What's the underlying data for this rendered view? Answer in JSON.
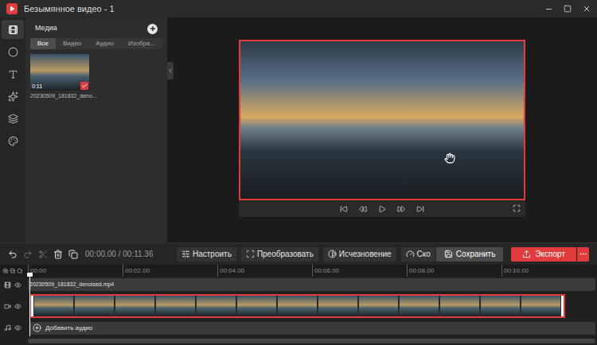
{
  "window": {
    "title": "Безымянное видео - 1"
  },
  "sidebar": {
    "items": [
      {
        "selected": true
      },
      {
        "selected": false
      },
      {
        "selected": false
      },
      {
        "selected": false
      },
      {
        "selected": false
      },
      {
        "selected": false
      }
    ]
  },
  "media": {
    "title": "Медиа",
    "tabs": [
      {
        "label": "Все",
        "selected": true
      },
      {
        "label": "Видео",
        "selected": false
      },
      {
        "label": "Аудио",
        "selected": false
      },
      {
        "label": "Изобра...",
        "selected": false
      }
    ],
    "items": [
      {
        "name": "20230509_181832_deno...",
        "duration": "0:11",
        "checked": true
      }
    ]
  },
  "preview": {
    "selected": true
  },
  "toolbar": {
    "tools": [
      {
        "disabled": false
      },
      {
        "disabled": true
      },
      {
        "disabled": true
      },
      {
        "disabled": false
      },
      {
        "disabled": false
      }
    ],
    "time": "00:00.00 / 00:11.36",
    "actions": [
      {
        "label": "Настроить"
      },
      {
        "label": "Преобразовать"
      },
      {
        "label": "Исчезновение"
      },
      {
        "label": "Ско"
      }
    ],
    "save": "Сохранить",
    "export": "Экспорт"
  },
  "timeline": {
    "ruler": [
      "00:00",
      "00:02.00",
      "00:04.00",
      "00:06.00",
      "00:08.00",
      "00:10.00"
    ],
    "playhead": 0,
    "title_clip": "20230509_181832_denoised.mp4",
    "video_clip": {
      "selected": true
    },
    "audio": {
      "label": "Добавить аудио"
    }
  }
}
